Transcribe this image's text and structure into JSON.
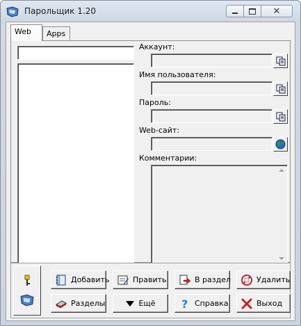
{
  "window": {
    "title": "Парольщик 1.20"
  },
  "tabs": [
    {
      "label": "Web",
      "active": true
    },
    {
      "label": "Apps",
      "active": false
    }
  ],
  "search": {
    "value": ""
  },
  "fields": {
    "account_label": "Аккаунт:",
    "username_label": "Имя пользователя:",
    "password_label": "Пароль:",
    "website_label": "Web-сайт:",
    "comments_label": "Комментарии:"
  },
  "buttons": {
    "add": "Добавить",
    "edit": "Править",
    "to_section": "В раздел",
    "delete": "Удалить",
    "sections": "Разделы",
    "more": "Ещё",
    "help": "Справка",
    "exit": "Выход"
  },
  "icons": {
    "app": "app-card-icon",
    "copy": "copy-icon",
    "globe": "globe-icon",
    "add": "notebook-add-icon",
    "edit": "edit-card-icon",
    "to_section": "move-to-section-icon",
    "delete": "delete-icon",
    "sections": "sections-icon",
    "more": "dropdown-arrow-icon",
    "help": "help-icon",
    "exit": "exit-icon"
  },
  "colors": {
    "accent": "#1f5fb5",
    "delete_red": "#c0202a"
  }
}
